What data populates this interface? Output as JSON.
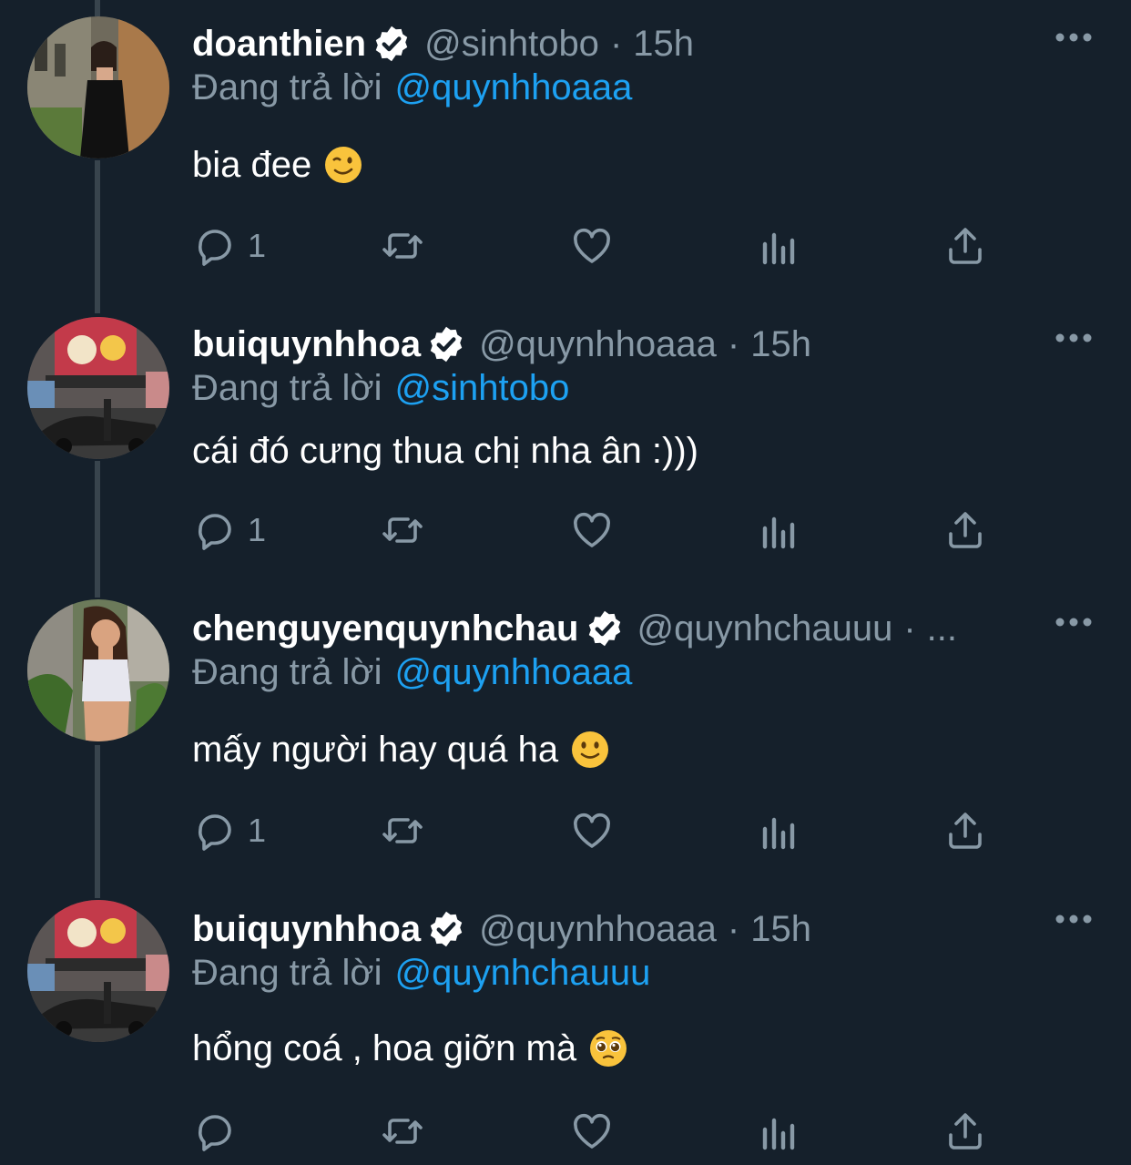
{
  "colors": {
    "background": "#15202b",
    "secondary_text": "#8899a6",
    "link": "#1da1f2",
    "thread_line": "#38444d"
  },
  "tweets": [
    {
      "display_name": "doanthien",
      "handle": "@sinhtobo",
      "separator": "·",
      "time": "15h",
      "reply_label": "Đang trả lời",
      "reply_to": "@quynhhoaaa",
      "text": "bia đee",
      "emoji": "winking-face",
      "reply_count": "1",
      "avatar": "woman-black-dress-avatar"
    },
    {
      "display_name": "buiquynhhoa",
      "handle": "@quynhhoaaa",
      "separator": "·",
      "time": "15h",
      "reply_label": "Đang trả lời",
      "reply_to": "@sinhtobo",
      "text": "cái đó cưng thua chị nha ân :)))",
      "emoji": "",
      "reply_count": "1",
      "avatar": "yuzu-ramen-storefront-avatar"
    },
    {
      "display_name": "chenguyenquynhchau",
      "handle": "@quynhchauuu",
      "separator": "·",
      "time": "...",
      "reply_label": "Đang trả lời",
      "reply_to": "@quynhhoaaa",
      "text": "mấy người hay quá ha",
      "emoji": "slightly-smiling-face",
      "reply_count": "1",
      "avatar": "woman-white-top-avatar"
    },
    {
      "display_name": "buiquynhhoa",
      "handle": "@quynhhoaaa",
      "separator": "·",
      "time": "15h",
      "reply_label": "Đang trả lời",
      "reply_to": "@quynhchauuu",
      "text": "hổng coá , hoa giỡn mà",
      "emoji": "pleading-face",
      "reply_count": "",
      "avatar": "yuzu-ramen-storefront-avatar"
    }
  ],
  "icons": {
    "reply": "reply-icon",
    "retweet": "retweet-icon",
    "like": "like-icon",
    "analytics": "analytics-icon",
    "share": "share-icon",
    "more": "more-icon",
    "verified": "verified-badge-icon"
  }
}
